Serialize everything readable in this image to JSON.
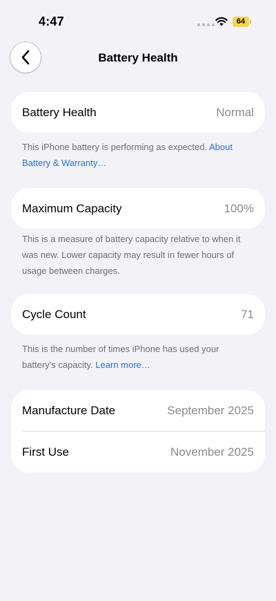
{
  "status_bar": {
    "time": "4:47",
    "battery_level": "64"
  },
  "nav": {
    "title": "Battery Health"
  },
  "battery_health": {
    "label": "Battery Health",
    "value": "Normal",
    "footnote": "This iPhone battery is performing as expected.",
    "link": "About Battery & Warranty…"
  },
  "maximum_capacity": {
    "label": "Maximum Capacity",
    "value": "100%",
    "footnote": "This is a measure of battery capacity relative to when it was new. Lower capacity may result in fewer hours of usage between charges."
  },
  "cycle_count": {
    "label": "Cycle Count",
    "value": "71",
    "footnote": "This is the number of times iPhone has used your battery's capacity.",
    "link": "Learn more…"
  },
  "dates": {
    "manufacture_label": "Manufacture Date",
    "manufacture_value": "September 2025",
    "first_use_label": "First Use",
    "first_use_value": "November 2025"
  },
  "colors": {
    "background": "#f2f2f7",
    "link": "#2f6fd0",
    "battery_fill": "#f5d64a"
  }
}
